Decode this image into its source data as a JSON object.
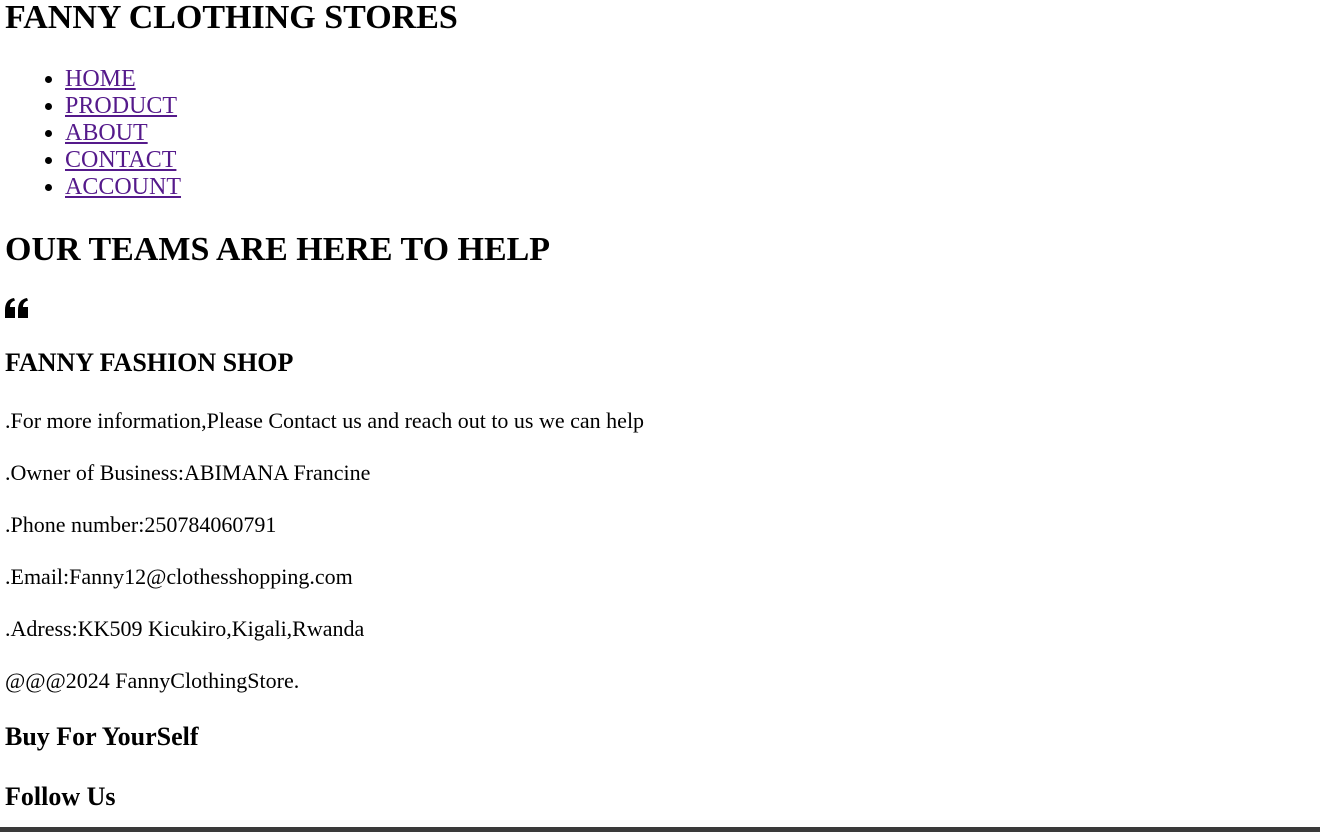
{
  "header": {
    "title": "FANNY CLOTHING STORES"
  },
  "nav": {
    "items": [
      {
        "label": "HOME"
      },
      {
        "label": "PRODUCT"
      },
      {
        "label": "ABOUT"
      },
      {
        "label": "CONTACT"
      },
      {
        "label": "ACCOUNT"
      }
    ],
    "link_color": "#551a8b"
  },
  "help": {
    "heading": "OUR TEAMS ARE HERE TO HELP",
    "icon": "quote-left-icon"
  },
  "shop": {
    "name": "FANNY FASHION SHOP",
    "info_lines": [
      ".For more information,Please Contact us and reach out to us we can help",
      ".Owner of Business:ABIMANA Francine",
      ".Phone number:250784060791",
      ".Email:Fanny12@clothesshopping.com",
      ".Adress:KK509 Kicukiro,Kigali,Rwanda",
      "@@@2024 FannyClothingStore."
    ]
  },
  "footer": {
    "buy_heading": "Buy For YourSelf",
    "follow_heading": "Follow Us"
  }
}
